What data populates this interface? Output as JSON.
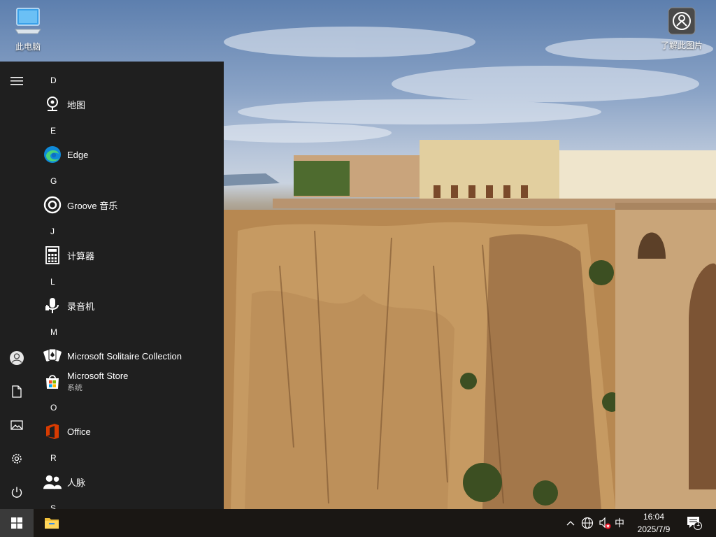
{
  "desktop": {
    "icons": [
      {
        "label": "此电脑",
        "icon": "computer-icon"
      },
      {
        "label": "了解此图片",
        "icon": "camera-info-icon"
      }
    ]
  },
  "start_menu": {
    "rail": [
      "hamburger-menu-icon",
      "user-avatar-icon",
      "document-icon",
      "pictures-icon",
      "settings-gear-icon",
      "power-icon"
    ],
    "groups": [
      {
        "letter": "D",
        "apps": [
          {
            "name": "地图",
            "icon": "maps-icon"
          }
        ]
      },
      {
        "letter": "E",
        "apps": [
          {
            "name": "Edge",
            "icon": "edge-icon"
          }
        ]
      },
      {
        "letter": "G",
        "apps": [
          {
            "name": "Groove 音乐",
            "icon": "groove-music-icon"
          }
        ]
      },
      {
        "letter": "J",
        "apps": [
          {
            "name": "计算器",
            "icon": "calculator-icon"
          }
        ]
      },
      {
        "letter": "L",
        "apps": [
          {
            "name": "录音机",
            "icon": "voice-recorder-icon"
          }
        ]
      },
      {
        "letter": "M",
        "apps": [
          {
            "name": "Microsoft Solitaire Collection",
            "icon": "solitaire-icon"
          },
          {
            "name": "Microsoft Store",
            "sub": "系统",
            "icon": "store-icon"
          }
        ]
      },
      {
        "letter": "O",
        "apps": [
          {
            "name": "Office",
            "icon": "office-icon"
          }
        ]
      },
      {
        "letter": "R",
        "apps": [
          {
            "name": "人脉",
            "icon": "people-icon"
          }
        ]
      },
      {
        "letter": "S",
        "apps": []
      }
    ]
  },
  "taskbar": {
    "pinned": [
      "windows-start-icon",
      "file-explorer-icon"
    ],
    "tray": {
      "icons": [
        "chevron-up-icon",
        "network-globe-icon",
        "volume-muted-icon"
      ],
      "ime": "中",
      "time": "16:04",
      "date": "2025/7/9",
      "notification_count": "1"
    }
  },
  "colors": {
    "start_bg": "#1f1f1f",
    "taskbar_bg": "#1a1714",
    "accent_office": "#d83b01",
    "accent_edge": "#0f8ad8"
  }
}
